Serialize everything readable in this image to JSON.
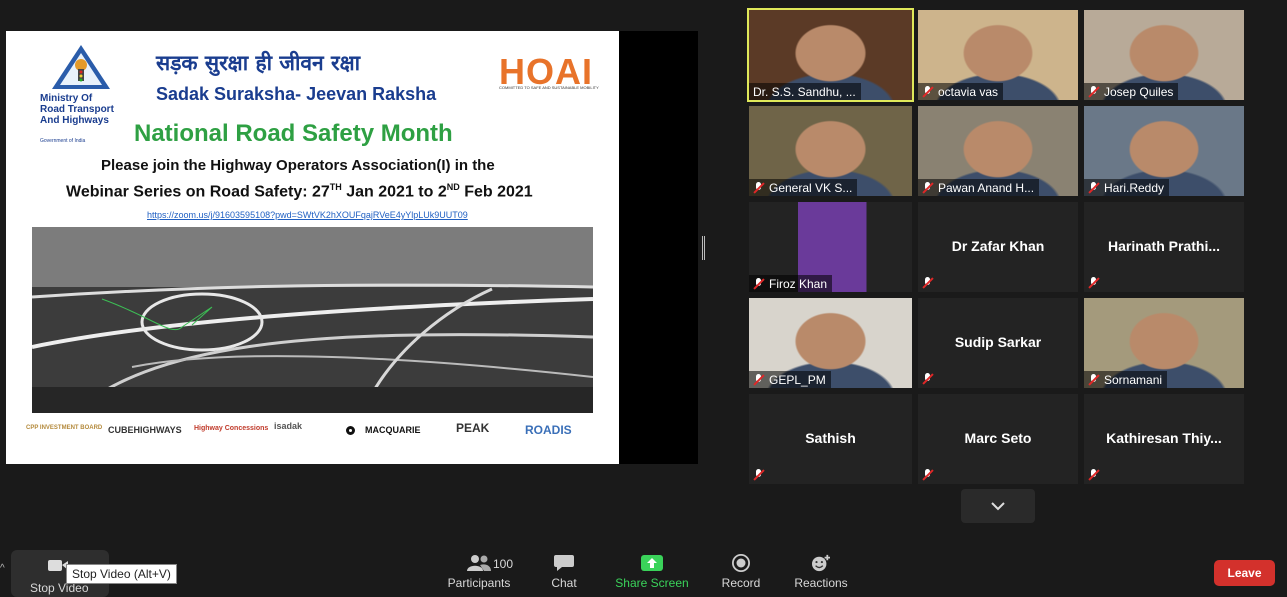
{
  "slide": {
    "mort_lines": [
      "Ministry Of",
      "Road Transport",
      "And Highways"
    ],
    "mort_sub": "Government of India",
    "hindi_title": "सड़क सुरक्षा ही जीवन रक्षा",
    "subtitle": "Sadak Suraksha- Jeevan Raksha",
    "hoai_logo": "HOAI",
    "hoai_tagline": "COMMITTED TO SAFE AND SUSTAINABLE MOBILITY",
    "main_title": "National Road Safety Month",
    "line1": "Please join the Highway Operators Association(I) in the",
    "line2_a": "Webinar Series on Road Safety: 27",
    "line2_sup1": "TH",
    "line2_b": " Jan 2021 to 2",
    "line2_sup2": "ND",
    "line2_c": " Feb 2021",
    "zoom_link": "https://zoom.us/j/91603595108?pwd=SWtVK2hXOUFqajRVeE4yYlpLUk9UUT09",
    "sponsors": [
      "CPP INVESTMENT BOARD",
      "CUBEHIGHWAYS",
      "Highway Concessions",
      "isadak",
      "MACQUARIE",
      "PEAK",
      "ROADIS"
    ]
  },
  "participants": [
    {
      "name": "Dr. S.S. Sandhu, ...",
      "video": true,
      "speaking": true,
      "muted": false,
      "bg": "#5b3a26"
    },
    {
      "name": "octavia vas",
      "video": true,
      "speaking": false,
      "muted": true,
      "bg": "#cdb48c"
    },
    {
      "name": "Josep Quiles",
      "video": true,
      "speaking": false,
      "muted": true,
      "bg": "#b8aa98"
    },
    {
      "name": "General VK S...",
      "video": true,
      "speaking": false,
      "muted": true,
      "bg": "#6f6448"
    },
    {
      "name": "Pawan Anand H...",
      "video": true,
      "speaking": false,
      "muted": true,
      "bg": "#8a8272"
    },
    {
      "name": "Hari.Reddy",
      "video": true,
      "speaking": false,
      "muted": true,
      "bg": "#6a7888"
    },
    {
      "name": "Firoz Khan",
      "video": true,
      "speaking": false,
      "muted": true,
      "bg": "#2d2d2d"
    },
    {
      "name": "Dr Zafar Khan",
      "video": false,
      "speaking": false,
      "muted": true
    },
    {
      "name": "Harinath  Prathi...",
      "video": false,
      "speaking": false,
      "muted": true
    },
    {
      "name": "GEPL_PM",
      "video": true,
      "speaking": false,
      "muted": true,
      "bg": "#d8d4cc"
    },
    {
      "name": "Sudip Sarkar",
      "video": false,
      "speaking": false,
      "muted": true
    },
    {
      "name": "Sornamani",
      "video": true,
      "speaking": false,
      "muted": true,
      "bg": "#a49a7c"
    },
    {
      "name": "Sathish",
      "video": false,
      "speaking": false,
      "muted": true
    },
    {
      "name": "Marc Seto",
      "video": false,
      "speaking": false,
      "muted": true
    },
    {
      "name": "Kathiresan  Thiy...",
      "video": false,
      "speaking": false,
      "muted": true
    }
  ],
  "toolbar": {
    "stop_video": "Stop Video",
    "tooltip": "Stop Video (Alt+V)",
    "participants": "Participants",
    "participant_count": "100",
    "chat": "Chat",
    "share_screen": "Share Screen",
    "record": "Record",
    "reactions": "Reactions",
    "leave": "Leave"
  },
  "colors": {
    "accent_green": "#3ad35a",
    "leave_red": "#d3312c",
    "speaking_border": "#dfe85a"
  }
}
